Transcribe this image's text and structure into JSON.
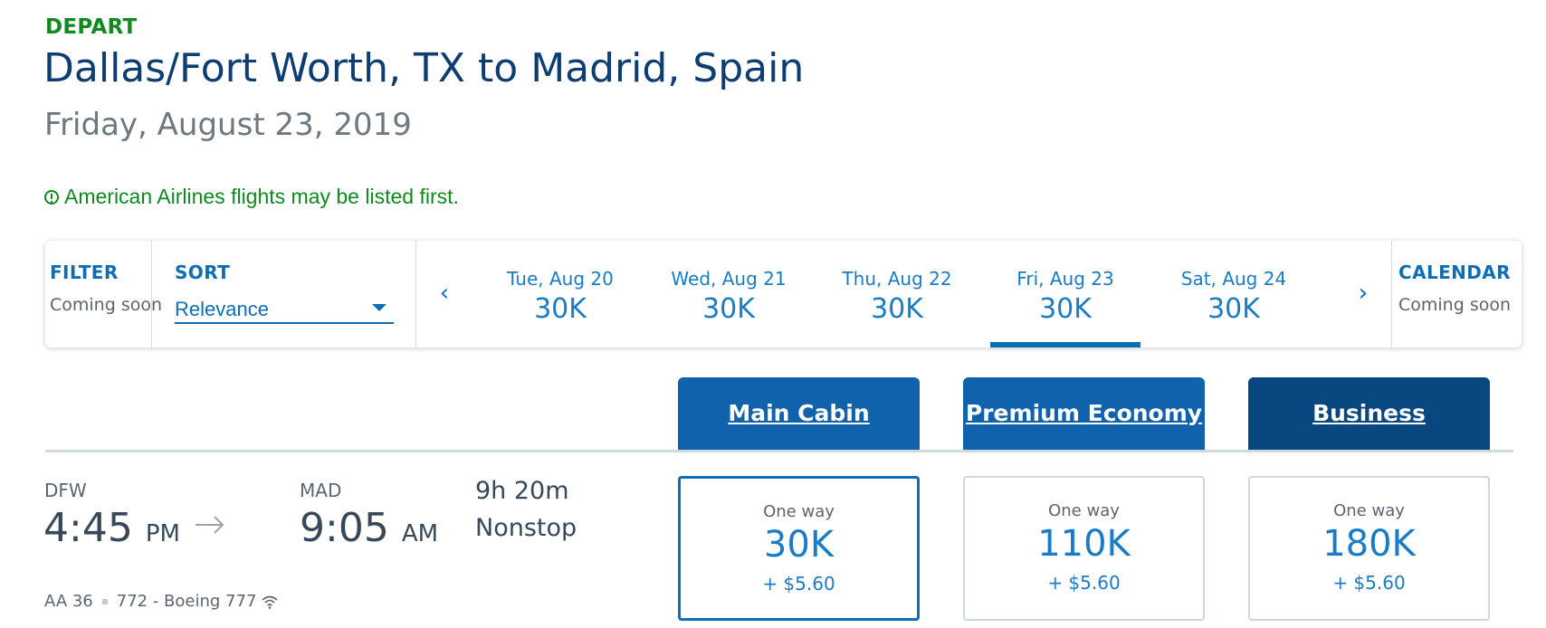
{
  "header": {
    "depart_label": "DEPART",
    "route": "Dallas/Fort Worth, TX to Madrid, Spain",
    "date": "Friday, August 23, 2019",
    "notice": "American Airlines flights may be listed first."
  },
  "toolbar": {
    "filter": {
      "heading": "FILTER",
      "sub": "Coming soon"
    },
    "sort": {
      "heading": "SORT",
      "value": "Relevance"
    },
    "prev_arrow": "‹",
    "next_arrow": "›",
    "dates": [
      {
        "label": "Tue, Aug 20",
        "price": "30K"
      },
      {
        "label": "Wed, Aug 21",
        "price": "30K"
      },
      {
        "label": "Thu, Aug 22",
        "price": "30K"
      },
      {
        "label": "Fri, Aug 23",
        "price": "30K",
        "selected": true
      },
      {
        "label": "Sat, Aug 24",
        "price": "30K"
      }
    ],
    "calendar": {
      "heading": "CALENDAR",
      "sub": "Coming soon"
    }
  },
  "cabins": [
    {
      "name": "Main Cabin"
    },
    {
      "name": "Premium Economy"
    },
    {
      "name": "Business"
    }
  ],
  "flight": {
    "origin_code": "DFW",
    "depart_time": "4:45",
    "depart_ampm": "PM",
    "dest_code": "MAD",
    "arrive_time": "9:05",
    "arrive_ampm": "AM",
    "duration": "9h 20m",
    "stops": "Nonstop",
    "flight_number": "AA 36",
    "aircraft": "772 - Boeing 777",
    "fares": [
      {
        "label": "One way",
        "points": "30K",
        "tax": "+ $5.60",
        "selected": true
      },
      {
        "label": "One way",
        "points": "110K",
        "tax": "+ $5.60"
      },
      {
        "label": "One way",
        "points": "180K",
        "tax": "+ $5.60"
      }
    ]
  }
}
